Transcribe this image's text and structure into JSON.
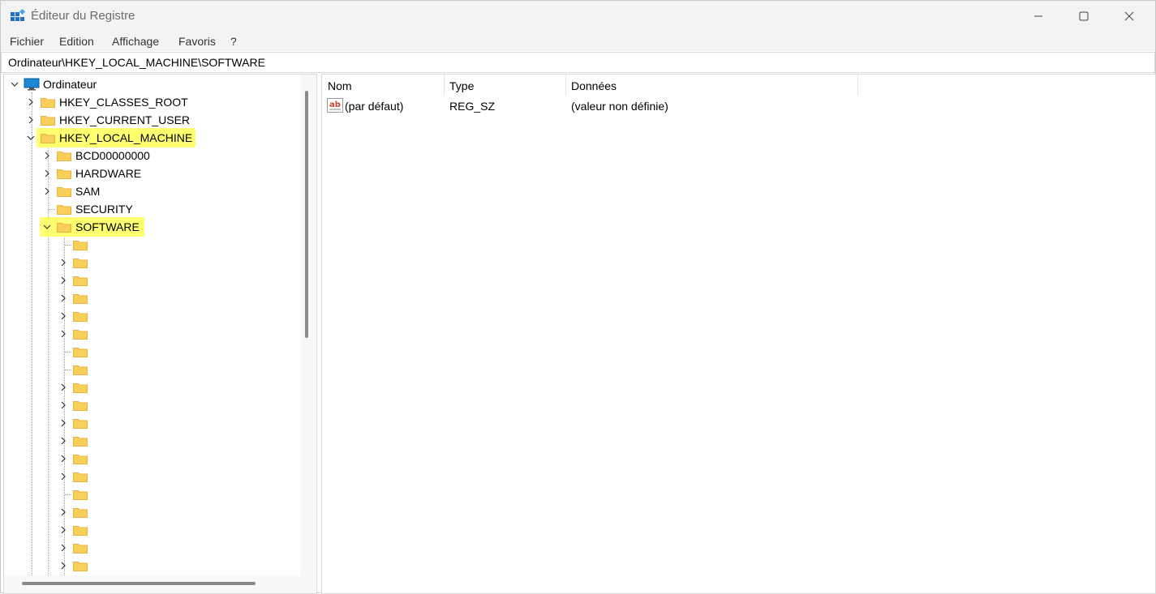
{
  "window": {
    "title": "Éditeur du Registre",
    "controls": {
      "minimize": "minimize",
      "maximize": "maximize",
      "close": "close"
    }
  },
  "menu": [
    "Fichier",
    "Edition",
    "Affichage",
    "Favoris",
    "?"
  ],
  "address": "Ordinateur\\HKEY_LOCAL_MACHINE\\SOFTWARE",
  "tree": {
    "root": "Ordinateur",
    "hives": [
      {
        "label": "HKEY_CLASSES_ROOT",
        "expanded": false
      },
      {
        "label": "HKEY_CURRENT_USER",
        "expanded": false
      },
      {
        "label": "HKEY_LOCAL_MACHINE",
        "expanded": true,
        "highlighted": true
      }
    ],
    "hklm_children": [
      {
        "label": "BCD00000000",
        "has_children": true
      },
      {
        "label": "HARDWARE",
        "has_children": true
      },
      {
        "label": "SAM",
        "has_children": true
      },
      {
        "label": "SECURITY",
        "has_children": false
      },
      {
        "label": "SOFTWARE",
        "has_children": true,
        "expanded": true,
        "highlighted": true
      }
    ],
    "software_subkeys_expandable": [
      false,
      true,
      true,
      true,
      true,
      true,
      false,
      false,
      true,
      true,
      true,
      true,
      true,
      true,
      false,
      true,
      true,
      true,
      true
    ]
  },
  "values_table": {
    "columns": [
      "Nom",
      "Type",
      "Données"
    ],
    "rows": [
      {
        "name": "(par défaut)",
        "type": "REG_SZ",
        "data": "(valeur non définie)",
        "icon": "string-value-icon"
      }
    ]
  },
  "colors": {
    "highlight": "#ffff70",
    "folder": "#f8cf5a",
    "folder_dark": "#e8b440",
    "computer_icon": "#1e88d6"
  }
}
